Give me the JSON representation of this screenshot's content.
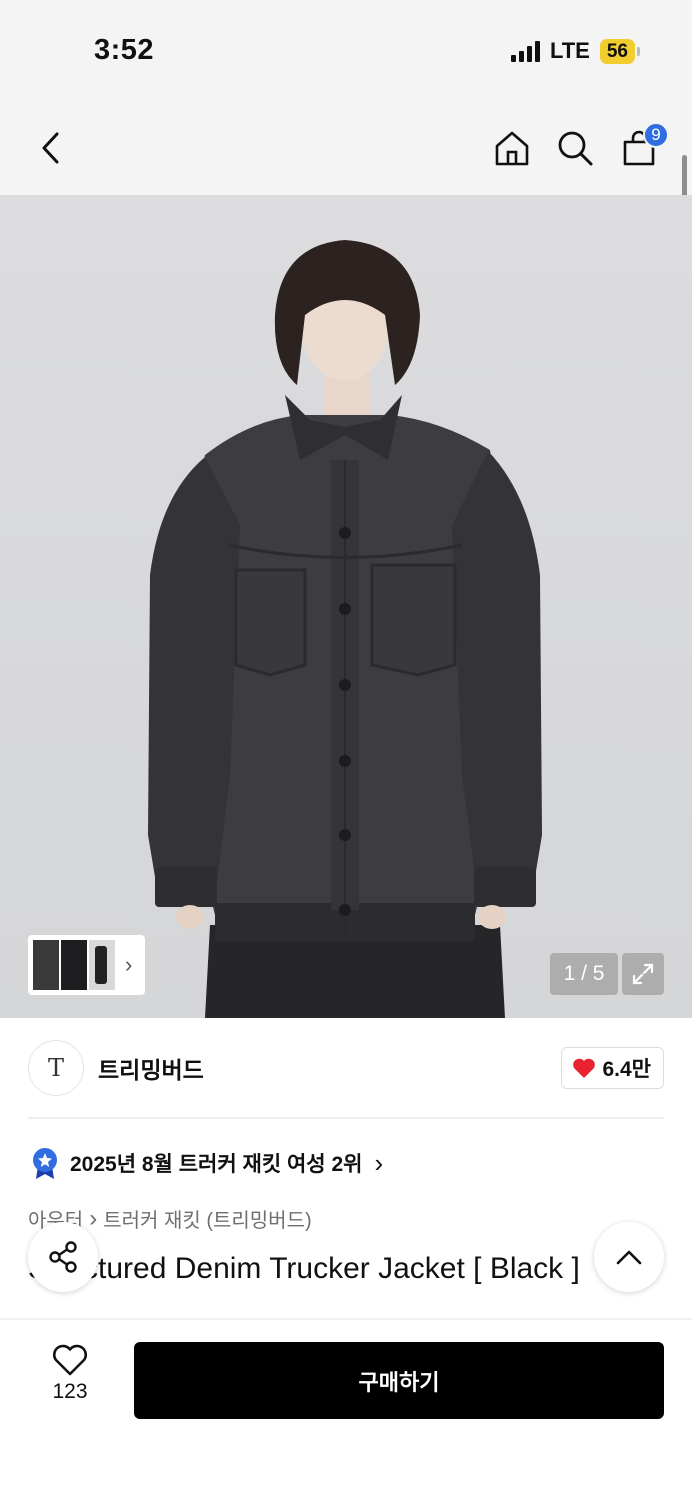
{
  "status_bar": {
    "time": "3:52",
    "network": "LTE",
    "battery": "56"
  },
  "nav": {
    "cart_count": "9"
  },
  "gallery": {
    "counter": "1 / 5"
  },
  "brand": {
    "logo_text": "T",
    "name": "트리밍버드",
    "like_count": "6.4만"
  },
  "ranking": {
    "text": "2025년 8월 트러커 재킷 여성 2위",
    "chevron": "›"
  },
  "breadcrumb": {
    "level1": "아우터",
    "separator": "›",
    "level2": "트러커 재킷 (트리밍버드)"
  },
  "product": {
    "title": "Structured Denim Trucker Jacket [ Black ]"
  },
  "bottom_bar": {
    "wish_count": "123",
    "buy_label": "구매하기"
  },
  "colors": {
    "accent_blue": "#2f6de1",
    "heart_red": "#e8222e",
    "battery_yellow": "#f2cd2e",
    "buy_bg": "#000000"
  },
  "icons": [
    "back-icon",
    "home-icon",
    "search-icon",
    "cart-icon",
    "expand-icon",
    "heart-icon",
    "rank-badge-icon",
    "share-icon",
    "chevron-up-icon",
    "heart-outline-icon"
  ]
}
